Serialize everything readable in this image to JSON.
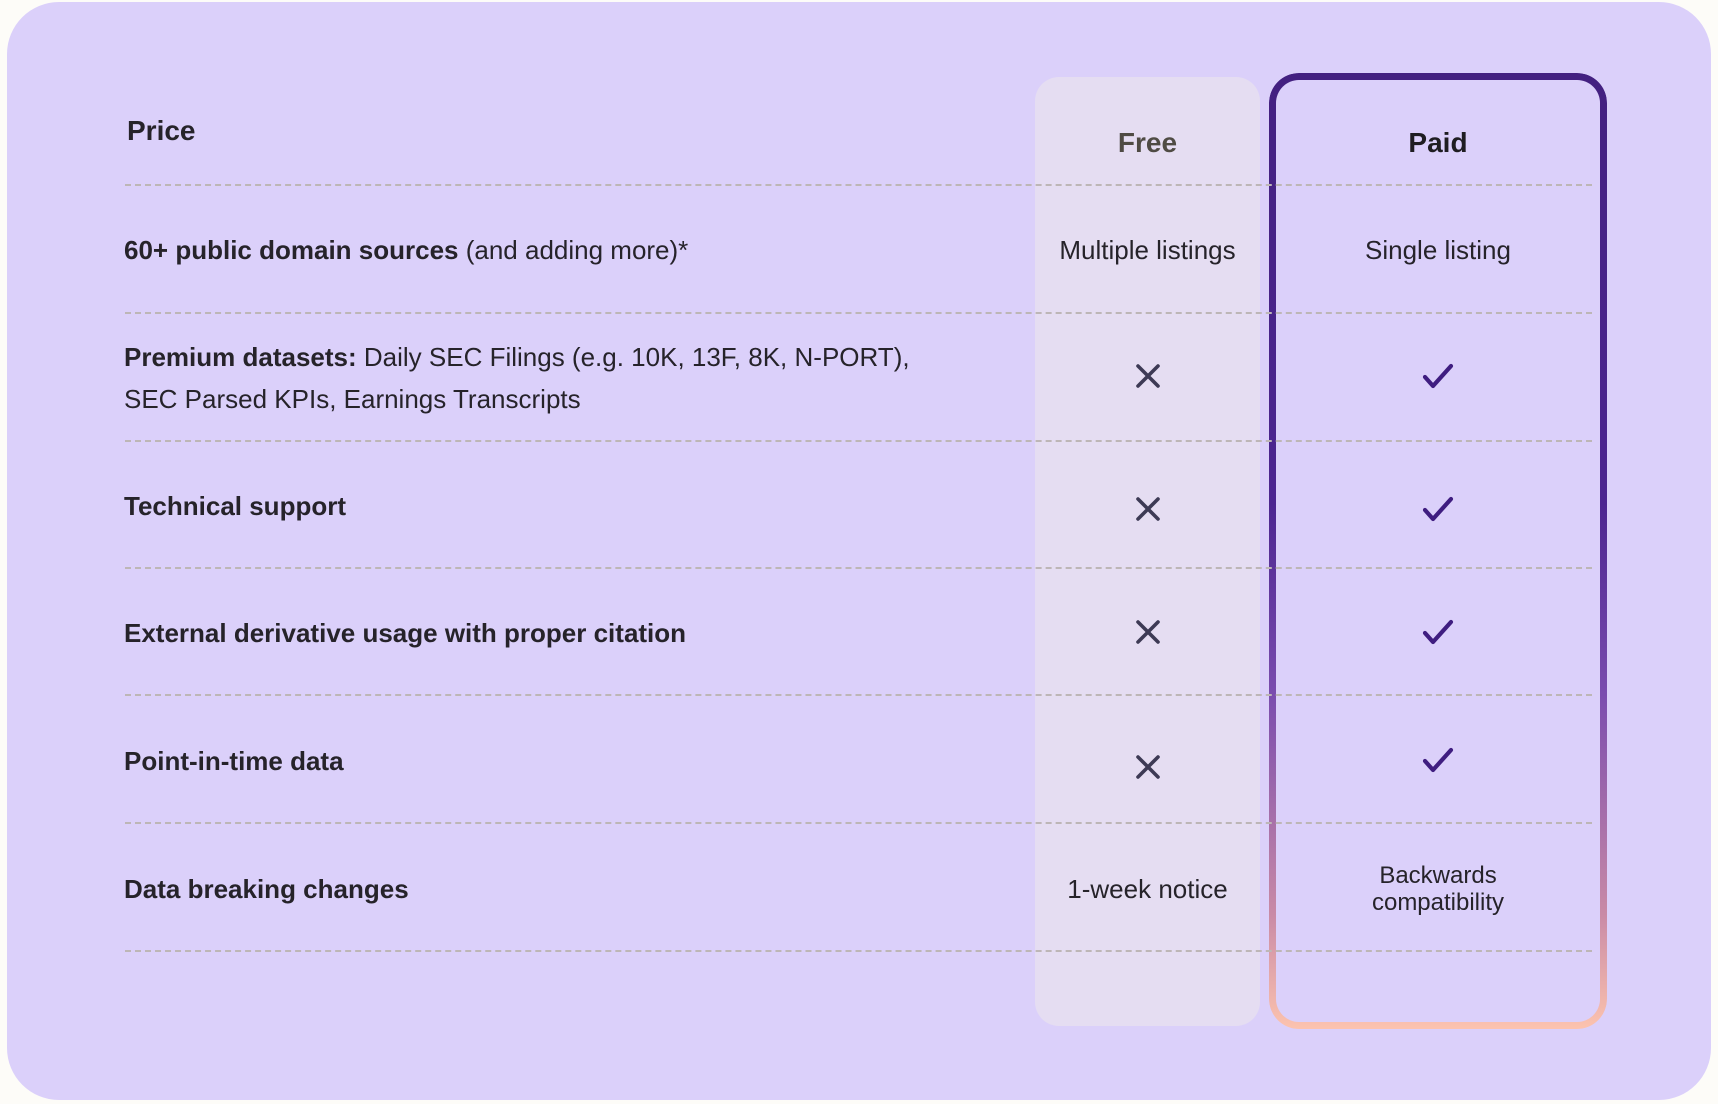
{
  "header": {
    "feature_col": "Price",
    "free_col": "Free",
    "paid_col": "Paid"
  },
  "colors": {
    "card_bg": "#dbd0fa",
    "free_col_bg": "#e5ddf2",
    "paid_border_top": "#432080",
    "paid_border_bottom": "#fcc3ae",
    "check": "#3f1d80",
    "cross": "#3d3a55",
    "divider": "#bdb6b6"
  },
  "rows": [
    {
      "label_bold": "60+ public domain sources",
      "label_rest": " (and adding more)*",
      "label_line2": "",
      "free": {
        "type": "text",
        "value": "Multiple listings"
      },
      "paid": {
        "type": "text",
        "value": "Single listing"
      }
    },
    {
      "label_bold": "Premium datasets:",
      "label_rest": " Daily SEC Filings  (e.g. 10K, 13F, 8K, N-PORT),",
      "label_line2": "SEC Parsed KPIs, Earnings Transcripts",
      "free": {
        "type": "icon",
        "icon": "cross-icon",
        "value": "Not included"
      },
      "paid": {
        "type": "icon",
        "icon": "check-icon",
        "value": "Included"
      }
    },
    {
      "label_bold": "Technical support",
      "label_rest": "",
      "label_line2": "",
      "free": {
        "type": "icon",
        "icon": "cross-icon",
        "value": "Not included"
      },
      "paid": {
        "type": "icon",
        "icon": "check-icon",
        "value": "Included"
      }
    },
    {
      "label_bold": "External derivative usage with proper citation",
      "label_rest": "",
      "label_line2": "",
      "free": {
        "type": "icon",
        "icon": "cross-icon",
        "value": "Not included"
      },
      "paid": {
        "type": "icon",
        "icon": "check-icon",
        "value": "Included"
      }
    },
    {
      "label_bold": "Point-in-time data",
      "label_rest": "",
      "label_line2": "",
      "free": {
        "type": "icon",
        "icon": "cross-icon",
        "value": "Not included"
      },
      "paid": {
        "type": "icon",
        "icon": "check-icon",
        "value": "Included"
      }
    },
    {
      "label_bold": "Data breaking changes",
      "label_rest": "",
      "label_line2": "",
      "free": {
        "type": "text",
        "value": "1-week notice"
      },
      "paid": {
        "type": "text",
        "value": "Backwards compatibility",
        "line1": "Backwards",
        "line2": "compatibility"
      }
    }
  ]
}
